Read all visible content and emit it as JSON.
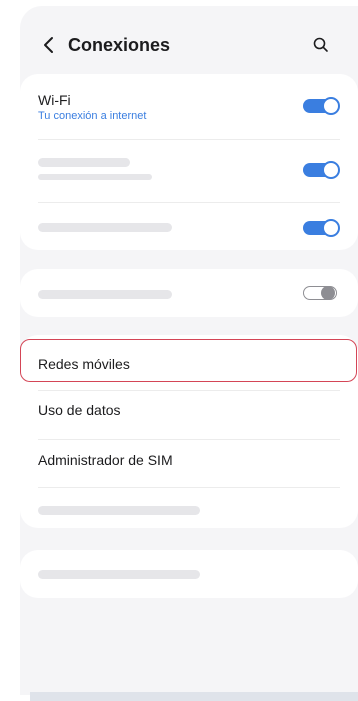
{
  "header": {
    "title": "Conexiones",
    "back_icon": "chevron-left-icon",
    "search_icon": "search-icon"
  },
  "connections": {
    "wifi": {
      "label": "Wi-Fi",
      "sublabel": "Tu conexión a internet",
      "enabled": true
    },
    "placeholder_row_1_enabled": true,
    "placeholder_row_2_enabled": true,
    "placeholder_row_3_enabled": false
  },
  "menu": {
    "items": [
      {
        "label": "Redes móviles",
        "highlighted": true
      },
      {
        "label": "Uso de datos"
      },
      {
        "label": "Administrador de SIM"
      }
    ]
  },
  "colors": {
    "accent": "#3a7ee0",
    "highlight": "#d44556",
    "toggle_off": "#8e8e93"
  }
}
